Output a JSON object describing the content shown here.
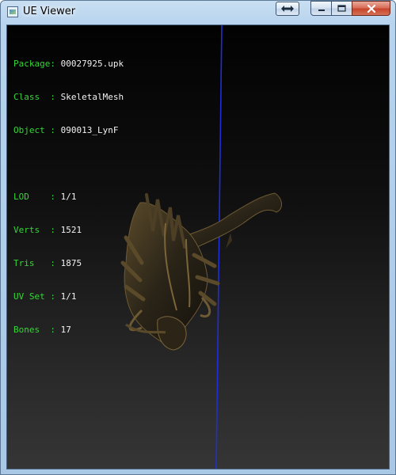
{
  "window": {
    "title": "UE Viewer"
  },
  "info": {
    "rows": [
      {
        "label": "Package",
        "value": "00027925.upk"
      },
      {
        "label": "Class  ",
        "value": "SkeletalMesh"
      },
      {
        "label": "Object ",
        "value": "090013_LynF"
      },
      {
        "label": "LOD    ",
        "value": "1/1"
      },
      {
        "label": "Verts  ",
        "value": "1521"
      },
      {
        "label": "Tris   ",
        "value": "1875"
      },
      {
        "label": "UV Set ",
        "value": "1/1"
      },
      {
        "label": "Bones  ",
        "value": "17"
      }
    ],
    "separator": ": "
  },
  "colors": {
    "label": "#36d636",
    "value": "#f2f2f2",
    "axis": "#1f2ed8",
    "viewport_top": "#020202",
    "viewport_bottom": "#353535"
  },
  "icons": {
    "app": "ue-viewer-app-icon",
    "extra": "double-arrow-icon",
    "minimize": "minimize-icon",
    "maximize": "maximize-icon",
    "close": "close-icon"
  }
}
